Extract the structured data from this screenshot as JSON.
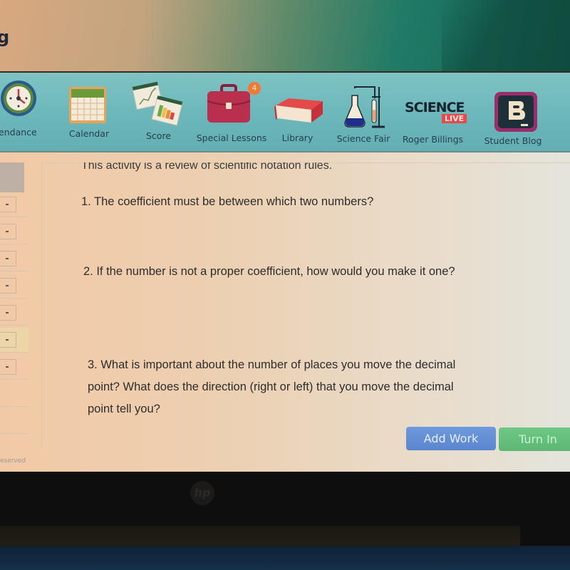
{
  "app": {
    "logo_text": "g"
  },
  "nav": {
    "items": [
      {
        "label": "ttendance",
        "icon": "clock-icon"
      },
      {
        "label": "Calendar",
        "icon": "calendar-icon"
      },
      {
        "label": "Score",
        "icon": "score-chart-icon"
      },
      {
        "label": "Special Lessons",
        "icon": "briefcase-icon",
        "badge": "4"
      },
      {
        "label": "Library",
        "icon": "book-icon"
      },
      {
        "label": "Science Fair",
        "icon": "lab-flask-icon"
      },
      {
        "label": "Roger Billings",
        "icon": "science-live-logo"
      },
      {
        "label": "Student Blog",
        "icon": "blogger-icon"
      }
    ],
    "science_live": {
      "line1": "SCIENCE",
      "line2": "LIVE"
    },
    "blog_glyph": "B"
  },
  "activity": {
    "intro": "This activity is a review of scientific notation rules.",
    "questions": [
      "1. The coefficient must be between which two numbers?",
      "2. If the number is not a proper coefficient, how would you make it one?",
      "3. What is important about the number of places you move the decimal point? What does the direction (right or left) that you move the decimal point tell you?"
    ],
    "question3_lines": [
      "3. What is important about the number of places you move the decimal",
      "point? What does the direction (right or left) that you move the decimal",
      "point tell you?"
    ]
  },
  "buttons": {
    "add_work": "Add Work",
    "turn_in": "Turn In"
  },
  "footer": {
    "text": "eserved"
  },
  "bezel": {
    "brand": "hp"
  },
  "colors": {
    "add_work": "#5f8bd3",
    "turn_in": "#63bd7a",
    "nav_bg": "#6db8bb",
    "badge": "#f07a33"
  }
}
